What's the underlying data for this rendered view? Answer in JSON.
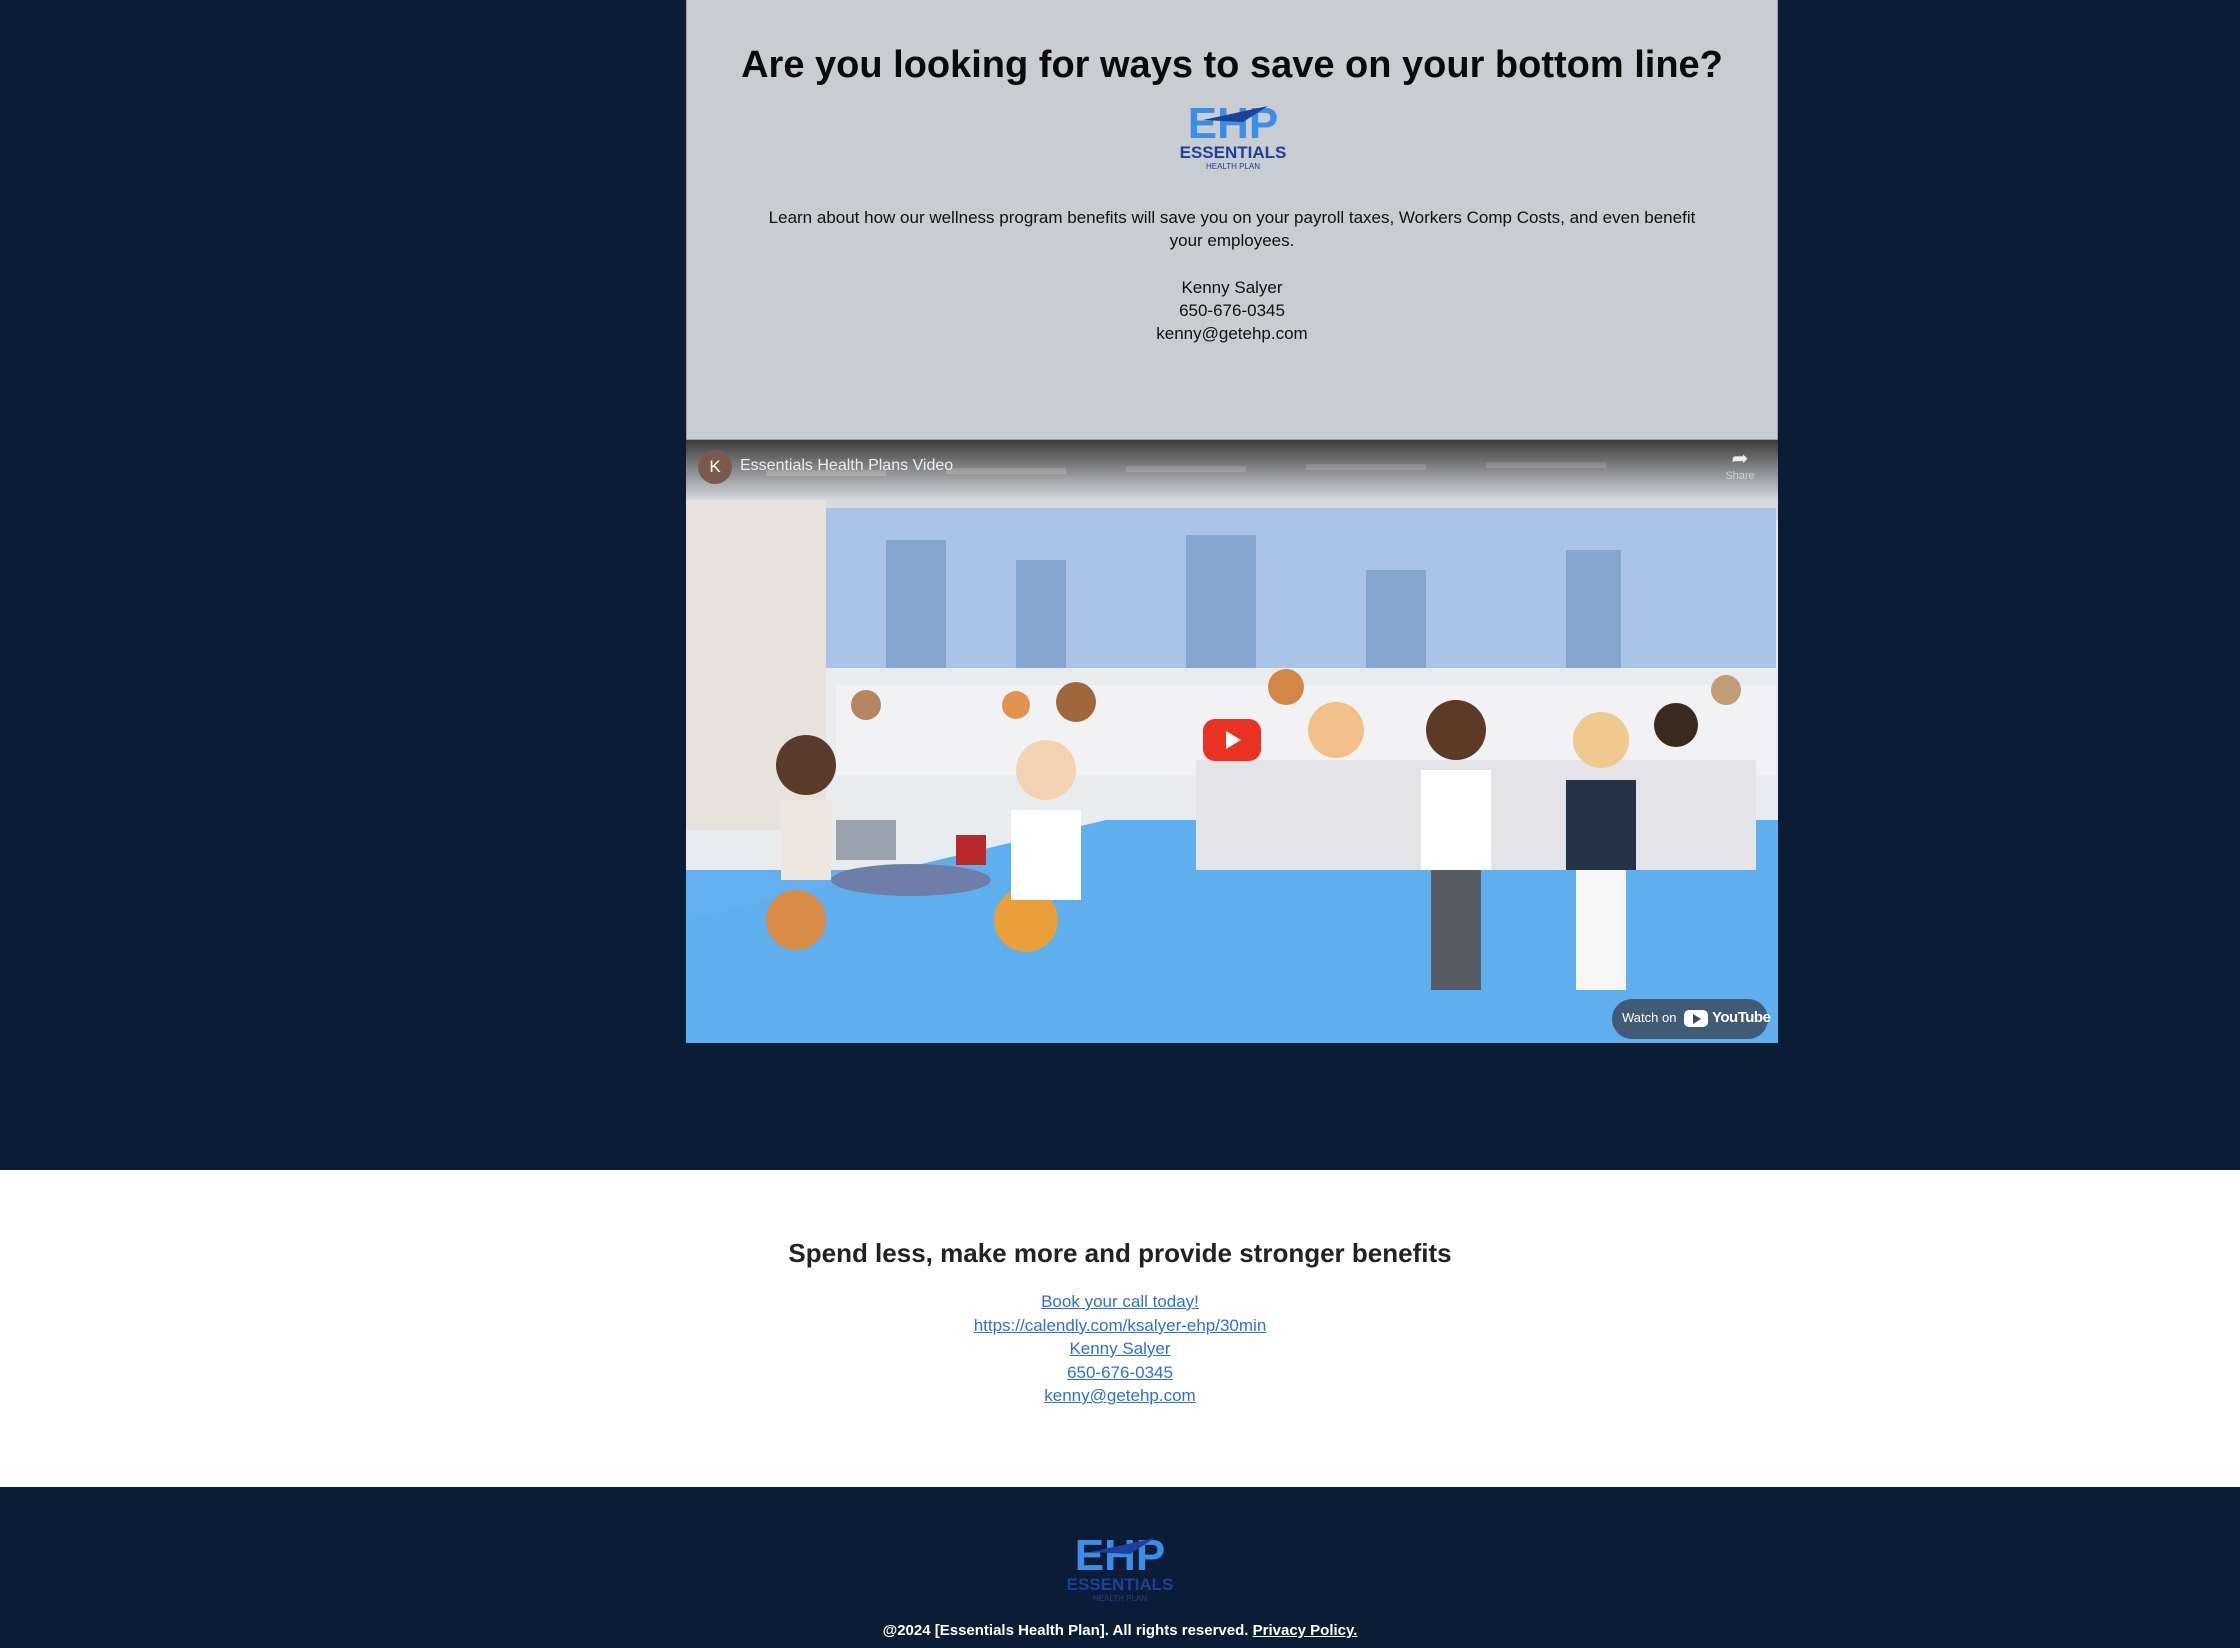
{
  "hero": {
    "headline": "Are you looking for ways to save on your bottom line?",
    "logo_text": "EHP",
    "logo_sub": "ESSENTIALS",
    "logo_sub2": "HEALTH PLAN",
    "description": "Learn about how our wellness program benefits will save you on your payroll taxes, Workers Comp Costs, and even benefit your employees.",
    "contact_name": "Kenny Salyer",
    "contact_phone": "650-676-0345",
    "contact_email": "kenny@getehp.com"
  },
  "video": {
    "channel_initial": "K",
    "title": "Essentials Health Plans Video",
    "share_label": "Share",
    "watch_on": "Watch on",
    "youtube": "YouTube"
  },
  "cta": {
    "heading": "Spend less, make more and provide stronger benefits",
    "links": [
      "Book your call today!",
      "https://calendly.com/ksalyer-ehp/30min",
      "Kenny Salyer",
      "650-676-0345",
      "kenny@getehp.com"
    ]
  },
  "footer": {
    "copyright": "@2024 [Essentials Health Plan]. All rights reserved.",
    "privacy": "Privacy Policy."
  },
  "colors": {
    "navy": "#0b1d36",
    "card": "#c8cdd1",
    "link": "#2f6fd6",
    "logo_blue": "#3a8ee6",
    "logo_dark": "#1f3f9a"
  }
}
